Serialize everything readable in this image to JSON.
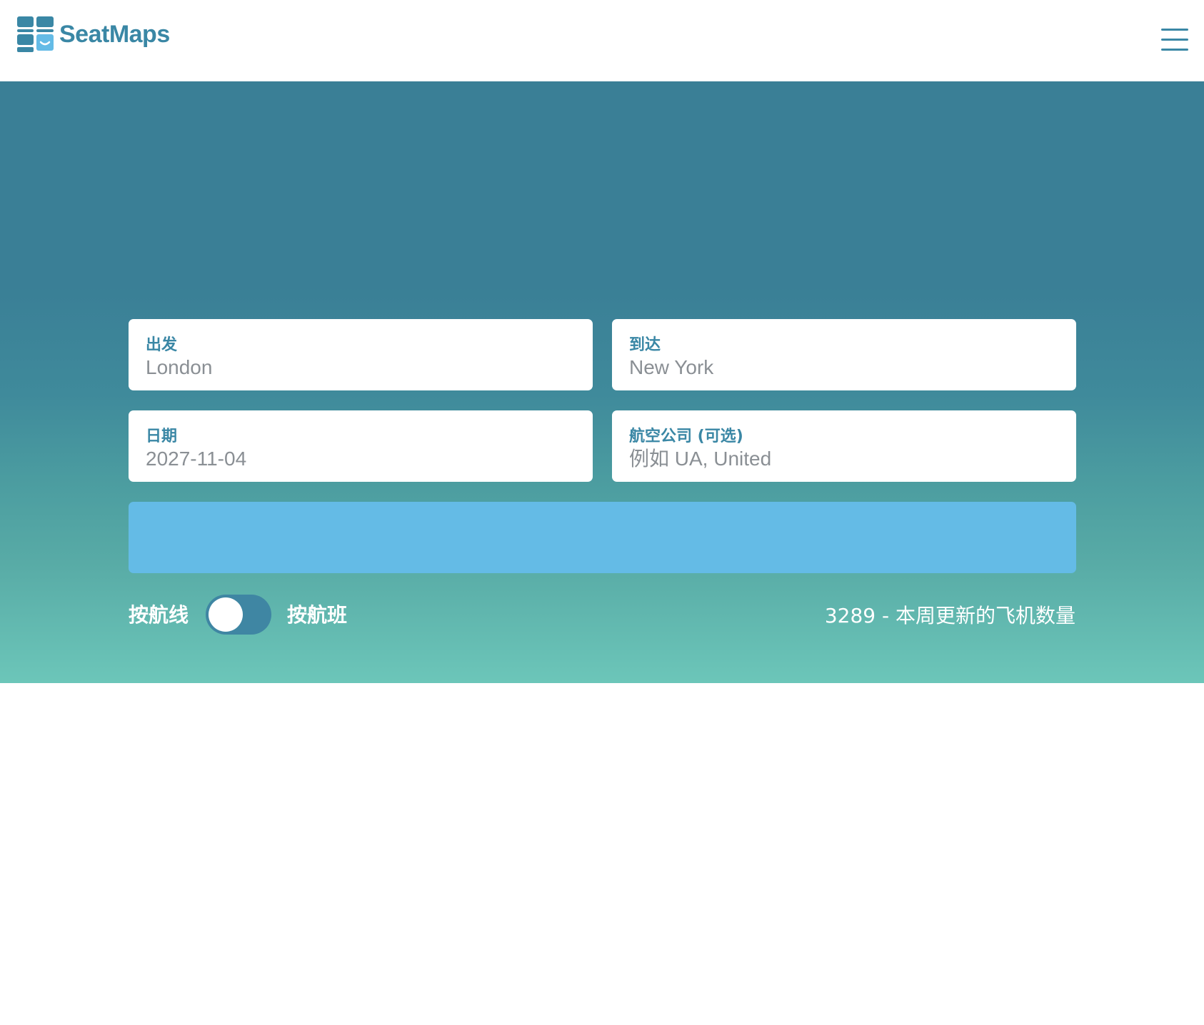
{
  "header": {
    "brand_name": "SeatMaps",
    "logo_icon": "seat-grid-logo-icon",
    "menu_icon": "hamburger-menu-icon"
  },
  "search_form": {
    "departure": {
      "label": "出发",
      "placeholder": "London"
    },
    "arrival": {
      "label": "到达",
      "placeholder": "New York"
    },
    "date": {
      "label": "日期",
      "value": "2027-11-04"
    },
    "airline": {
      "label": "航空公司 (可选)",
      "placeholder": "例如 UA, United"
    },
    "search_button_label": ""
  },
  "mode_toggle": {
    "left_label": "按航线",
    "right_label": "按航班",
    "selected": "按航线"
  },
  "stats": {
    "update_text": "3289 - 本周更新的飞机数量"
  },
  "colors": {
    "brand": "#3a87a5",
    "hero_top": "#3a7f96",
    "hero_bottom": "#6cc6b9",
    "button": "#64bbe6",
    "toggle_track": "#3f86a3"
  }
}
